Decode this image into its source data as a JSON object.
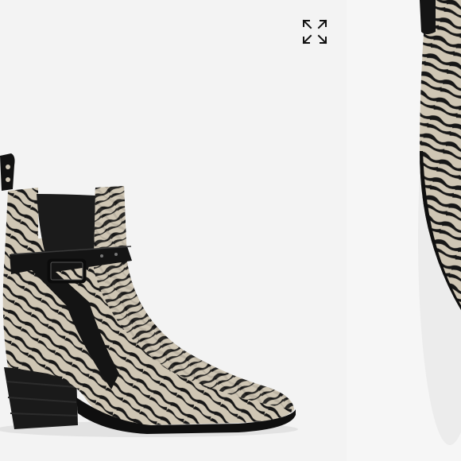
{
  "gallery": {
    "expand_icon": "expand-arrows-icon",
    "slides": [
      {
        "image": "zebra-print-ankle-boot-side-view",
        "colors": {
          "print_light": "#cfc6b4",
          "print_dark": "#161616",
          "leather": "#111111"
        }
      },
      {
        "image": "zebra-print-ankle-boot-detail-view"
      }
    ]
  }
}
